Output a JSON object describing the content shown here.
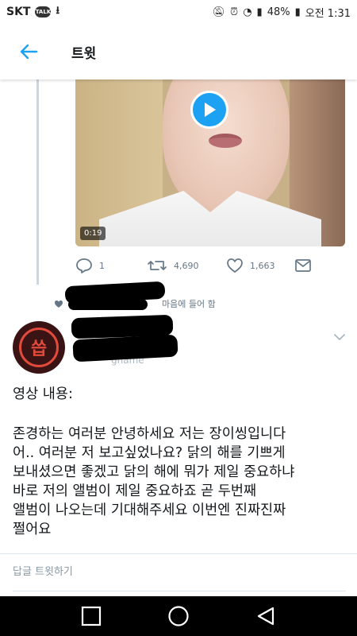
{
  "status_bar": {
    "carrier": "SKT",
    "talk_badge": "TALK",
    "battery": "48%",
    "time": "오전 1:31"
  },
  "header": {
    "title": "트윗"
  },
  "quoted_tweet": {
    "video_duration": "0:19",
    "reply_count": "1",
    "retweet_count": "4,690",
    "like_count": "1,663",
    "liked_text": "마음에 들어 함"
  },
  "tweet": {
    "avatar_glyph": "씁",
    "handle_partial": "gname",
    "text": [
      "영상 내용:",
      "",
      "존경하는 여러분 안녕하세요 저는 장이씽입니다",
      "어.. 여러분 저 보고싶었나요? 닭의 해를 기쁘게",
      "보내셨으면 좋겠고 닭의 해에 뭐가 제일 중요하냐",
      "바로 저의 앨범이 제일 중요하죠 곧 두번째",
      "앨범이 나오는데 기대해주세요 이번엔 진짜진짜",
      "쩔어요"
    ]
  },
  "reply": {
    "label": "답글 트윗하기"
  },
  "colors": {
    "accent": "#1da1f2",
    "muted": "#657786"
  },
  "icons": [
    "back-arrow-icon",
    "play-icon",
    "reply-icon",
    "retweet-icon",
    "like-icon",
    "message-icon",
    "heart-small-icon",
    "chevron-down-icon",
    "nav-recent-icon",
    "nav-home-icon",
    "nav-back-icon"
  ]
}
